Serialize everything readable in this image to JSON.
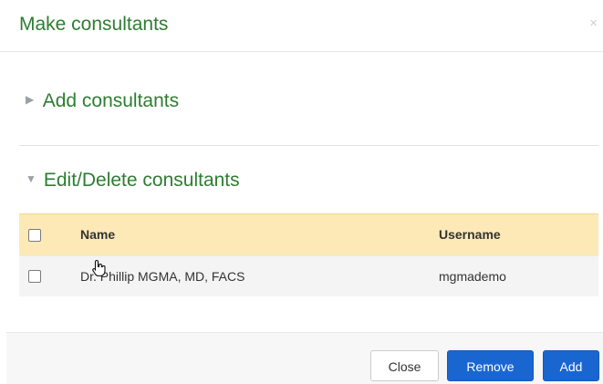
{
  "dialog": {
    "title": "Make consultants",
    "close_glyph": "×"
  },
  "sections": {
    "add": {
      "label": "Add consultants",
      "expanded": false,
      "arrow": "▶"
    },
    "edit": {
      "label": "Edit/Delete consultants",
      "expanded": true,
      "arrow": "▼"
    }
  },
  "table": {
    "headers": {
      "name": "Name",
      "username": "Username"
    },
    "rows": [
      {
        "name": "Dr. Phillip MGMA, MD, FACS",
        "username": "mgmademo"
      }
    ]
  },
  "footer": {
    "close_label": "Close",
    "remove_label": "Remove",
    "add_label": "Add"
  },
  "colors": {
    "title_green": "#2e7d32",
    "header_row": "#fce9b6",
    "primary_blue": "#1a66d1"
  },
  "icons": {
    "cursor": "hand-pointer-icon",
    "collapsed": "triangle-right-icon",
    "expanded": "triangle-down-icon",
    "close": "close-icon"
  }
}
